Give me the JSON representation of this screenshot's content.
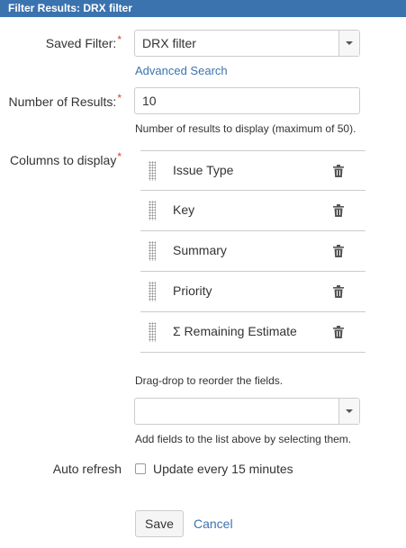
{
  "title": "Filter Results: DRX filter",
  "saved_filter": {
    "label": "Saved Filter:",
    "required": "*",
    "value": "DRX filter",
    "advanced_search": "Advanced Search"
  },
  "num_results": {
    "label": "Number of Results:",
    "required": "*",
    "value": "10",
    "help": "Number of results to display (maximum of 50)."
  },
  "columns": {
    "label": "Columns to display",
    "required": "*",
    "items": [
      {
        "label": "Issue Type"
      },
      {
        "label": "Key"
      },
      {
        "label": "Summary"
      },
      {
        "label": "Priority"
      },
      {
        "label": "Σ Remaining Estimate"
      }
    ],
    "reorder_help": "Drag-drop to reorder the fields.",
    "add_help": "Add fields to the list above by selecting them.",
    "add_value": ""
  },
  "auto_refresh": {
    "label": "Auto refresh",
    "option": "Update every 15 minutes",
    "checked": false
  },
  "buttons": {
    "save": "Save",
    "cancel": "Cancel"
  },
  "icons": {
    "drag": "drag-handle-icon",
    "trash": "trash-icon",
    "dropdown": "chevron-down-icon"
  },
  "colors": {
    "header": "#3b73af",
    "link": "#3b73af",
    "required": "#d04437"
  }
}
